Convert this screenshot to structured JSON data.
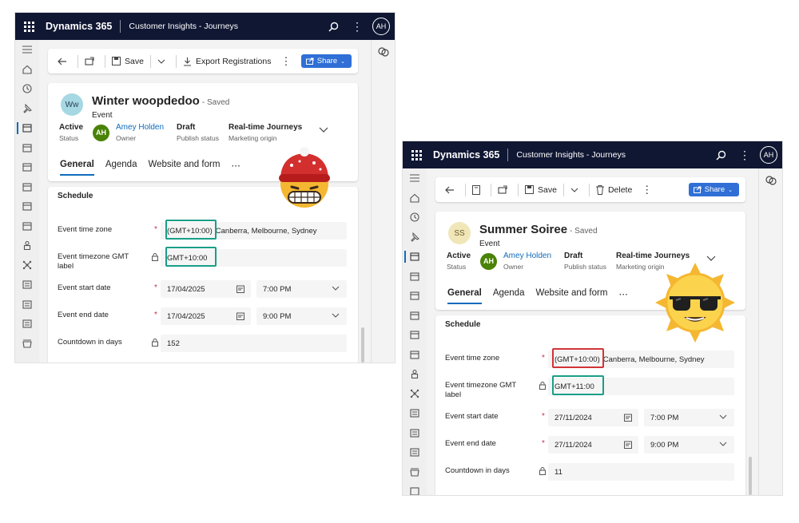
{
  "colors": {
    "accent": "#0f6cbd",
    "topbar": "#101733",
    "highlight_green": "#1a9e88",
    "highlight_red": "#d13438"
  },
  "app": {
    "brand": "Dynamics 365",
    "name": "Customer Insights - Journeys",
    "user_initials": "AH"
  },
  "icons": {
    "topbar": [
      "waffle-icon",
      "search-icon",
      "more-icon"
    ],
    "rail": [
      "hamburger-icon",
      "home-icon",
      "recent-icon",
      "pin-icon",
      "event-icon",
      "calendar-icon",
      "person-icon",
      "network-icon",
      "building-icon"
    ],
    "emoji": [
      "winter-beanie-face-icon",
      "sun-sunglasses-icon"
    ]
  },
  "windows": [
    {
      "commands": {
        "save": "Save",
        "export": "Export Registrations",
        "share": "Share"
      },
      "record": {
        "avatar": "Ww",
        "title": "Winter woopdedoo",
        "saved": "- Saved",
        "entity": "Event",
        "status_value": "Active",
        "status_label": "Status",
        "owner_initials": "AH",
        "owner_name": "Amey Holden",
        "owner_label": "Owner",
        "publish_value": "Draft",
        "publish_label": "Publish status",
        "origin_value": "Real-time Journeys",
        "origin_label": "Marketing origin"
      },
      "tabs": [
        "General",
        "Agenda",
        "Website and form",
        "⋯"
      ],
      "schedule": {
        "title": "Schedule",
        "timezone_label": "Event time zone",
        "timezone_code": "(GMT+10:00)",
        "timezone_city": "Canberra, Melbourne, Sydney",
        "gmt_label": "Event timezone GMT label",
        "gmt_value": "GMT+10:00",
        "start_label": "Event start date",
        "start_date": "17/04/2025",
        "start_time": "7:00 PM",
        "end_label": "Event end date",
        "end_date": "17/04/2025",
        "end_time": "9:00 PM",
        "countdown_label": "Countdown in days",
        "countdown_value": "152"
      }
    },
    {
      "commands": {
        "save": "Save",
        "delete": "Delete",
        "share": "Share"
      },
      "record": {
        "avatar": "SS",
        "title": "Summer Soiree",
        "saved": "- Saved",
        "entity": "Event",
        "status_value": "Active",
        "status_label": "Status",
        "owner_initials": "AH",
        "owner_name": "Amey Holden",
        "owner_label": "Owner",
        "publish_value": "Draft",
        "publish_label": "Publish status",
        "origin_value": "Real-time Journeys",
        "origin_label": "Marketing origin"
      },
      "tabs": [
        "General",
        "Agenda",
        "Website and form",
        "⋯"
      ],
      "schedule": {
        "title": "Schedule",
        "timezone_label": "Event time zone",
        "timezone_code": "(GMT+10:00)",
        "timezone_city": "Canberra, Melbourne, Sydney",
        "gmt_label": "Event timezone GMT label",
        "gmt_value": "GMT+11:00",
        "start_label": "Event start date",
        "start_date": "27/11/2024",
        "start_time": "7:00 PM",
        "end_label": "Event end date",
        "end_date": "27/11/2024",
        "end_time": "9:00 PM",
        "countdown_label": "Countdown in days",
        "countdown_value": "11"
      }
    }
  ]
}
